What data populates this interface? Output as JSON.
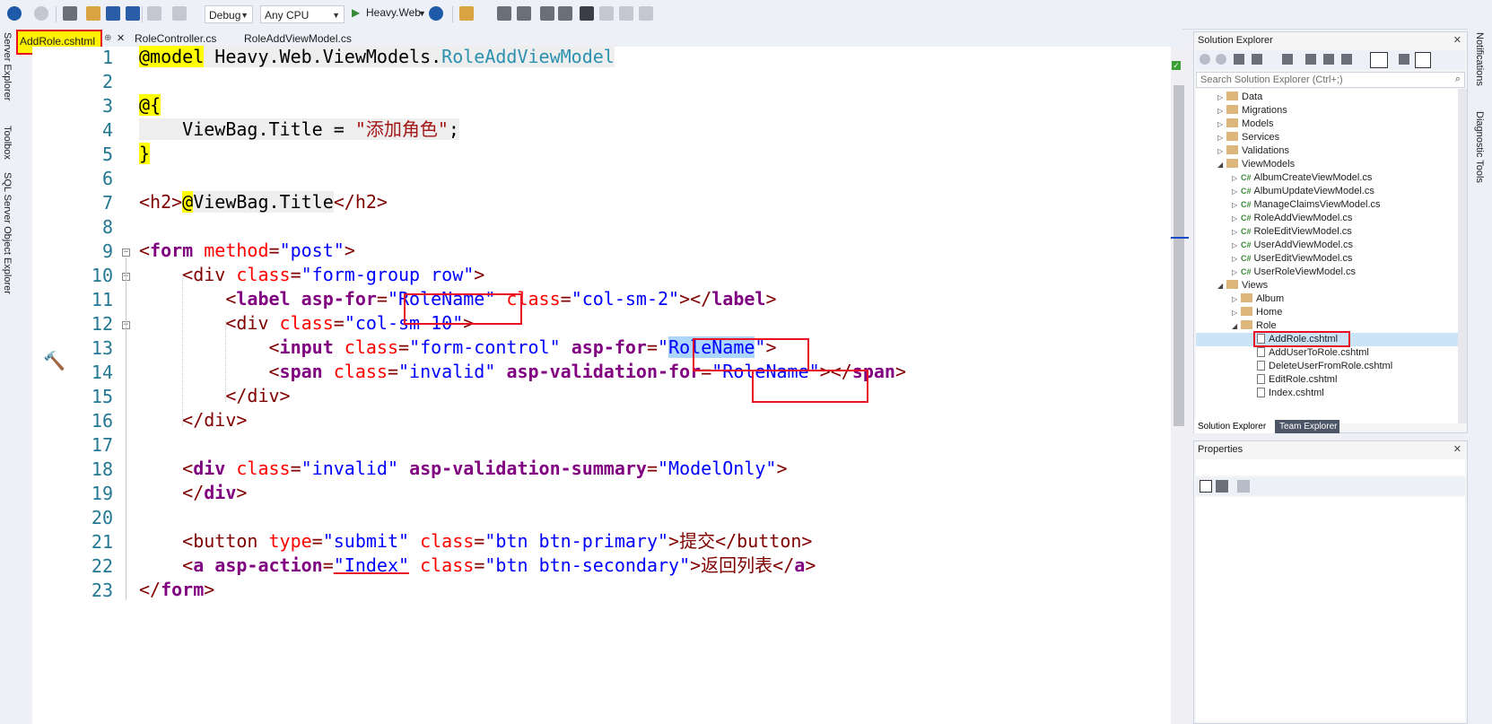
{
  "toolbar": {
    "config": "Debug",
    "platform": "Any CPU",
    "startup": "Heavy.Web"
  },
  "left_strip": [
    "Server Explorer",
    "Toolbox",
    "SQL Server Object Explorer"
  ],
  "right_strip": [
    "Notifications",
    "Diagnostic Tools"
  ],
  "tabs": [
    {
      "label": "AddRole.cshtml",
      "active": true
    },
    {
      "label": "RoleController.cs"
    },
    {
      "label": "RoleAddViewModel.cs"
    }
  ],
  "editor": {
    "line_numbers": [
      "1",
      "2",
      "3",
      "4",
      "5",
      "6",
      "7",
      "8",
      "9",
      "10",
      "11",
      "12",
      "13",
      "14",
      "15",
      "16",
      "17",
      "18",
      "19",
      "20",
      "21",
      "22",
      "23"
    ],
    "lines": {
      "l1": {
        "a": "@model",
        "b": " Heavy.Web.ViewModels.",
        "c": "RoleAddViewModel"
      },
      "l3": {
        "a": "@{"
      },
      "l4": {
        "a": "    ViewBag.Title = ",
        "b": "\"添加角色\"",
        "c": ";"
      },
      "l5": {
        "a": "}"
      },
      "l7": {
        "a": "<h2>",
        "b": "@",
        "c": "ViewBag.Title",
        "d": "</h2>"
      },
      "l9": {
        "a": "<",
        "b": "form",
        "c": " method",
        "d": "=",
        "e": "\"post\"",
        "f": ">"
      },
      "l10": {
        "a": "    <div ",
        "b": "class",
        "c": "=",
        "d": "\"form-group row\"",
        "e": ">"
      },
      "l11": {
        "a": "        <",
        "b": "label asp-for",
        "c": "=",
        "d": "\"RoleName\"",
        "e": " class",
        "f": "=",
        "g": "\"col-sm-2\"",
        "h": "></",
        "i": "label",
        "j": ">"
      },
      "l12": {
        "a": "        <div ",
        "b": "class",
        "c": "=",
        "d": "\"col-sm-10\"",
        "e": ">"
      },
      "l13": {
        "a": "            <",
        "b": "input",
        "c": " class",
        "d": "=",
        "e": "\"form-control\"",
        "f": " ",
        "g": "asp-for",
        "h": "=",
        "i": "\"",
        "j": "RoleName",
        "k": "\"",
        "l": ">"
      },
      "l14": {
        "a": "            <",
        "b": "span",
        "c": " class",
        "d": "=",
        "e": "\"invalid\"",
        "f": " ",
        "g": "asp-validation-for",
        "h": "=",
        "i": "\"RoleName\"",
        "j": "></",
        "k": "span",
        "l": ">"
      },
      "l15": {
        "a": "        </div>"
      },
      "l16": {
        "a": "    </div>"
      },
      "l18": {
        "a": "    <",
        "b": "div",
        "c": " class",
        "d": "=",
        "e": "\"invalid\"",
        "f": " ",
        "g": "asp-validation-summary",
        "h": "=",
        "i": "\"ModelOnly\"",
        "j": ">"
      },
      "l19": {
        "a": "    </",
        "b": "div",
        "c": ">"
      },
      "l21": {
        "a": "    <button ",
        "b": "type",
        "c": "=",
        "d": "\"submit\"",
        "e": " class",
        "f": "=",
        "g": "\"btn btn-primary\"",
        "h": ">提交</button>"
      },
      "l22": {
        "a": "    <",
        "b": "a asp-action",
        "c": "=",
        "d": "\"Index\"",
        "e": " class",
        "f": "=",
        "g": "\"btn btn-secondary\"",
        "h": ">返回列表</",
        "i": "a",
        "j": ">"
      },
      "l23": {
        "a": "</",
        "b": "form",
        "c": ">"
      }
    }
  },
  "solution_explorer": {
    "title": "Solution Explorer",
    "search_placeholder": "Search Solution Explorer (Ctrl+;)",
    "items": [
      {
        "label": "Data",
        "kind": "folder",
        "level": 1
      },
      {
        "label": "Migrations",
        "kind": "folder",
        "level": 1
      },
      {
        "label": "Models",
        "kind": "folder",
        "level": 1
      },
      {
        "label": "Services",
        "kind": "folder",
        "level": 1
      },
      {
        "label": "Validations",
        "kind": "folder",
        "level": 1
      },
      {
        "label": "ViewModels",
        "kind": "folder",
        "level": 1
      },
      {
        "label": "AlbumCreateViewModel.cs",
        "kind": "cs",
        "level": 2
      },
      {
        "label": "AlbumUpdateViewModel.cs",
        "kind": "cs",
        "level": 2
      },
      {
        "label": "ManageClaimsViewModel.cs",
        "kind": "cs",
        "level": 2
      },
      {
        "label": "RoleAddViewModel.cs",
        "kind": "cs",
        "level": 2
      },
      {
        "label": "RoleEditViewModel.cs",
        "kind": "cs",
        "level": 2
      },
      {
        "label": "UserAddViewModel.cs",
        "kind": "cs",
        "level": 2
      },
      {
        "label": "UserEditViewModel.cs",
        "kind": "cs",
        "level": 2
      },
      {
        "label": "UserRoleViewModel.cs",
        "kind": "cs",
        "level": 2
      },
      {
        "label": "Views",
        "kind": "folder",
        "level": 1
      },
      {
        "label": "Album",
        "kind": "folder",
        "level": 2
      },
      {
        "label": "Home",
        "kind": "folder",
        "level": 2
      },
      {
        "label": "Role",
        "kind": "folder",
        "level": 2
      },
      {
        "label": "AddRole.cshtml",
        "kind": "file",
        "level": 3
      },
      {
        "label": "AddUserToRole.cshtml",
        "kind": "file",
        "level": 3
      },
      {
        "label": "DeleteUserFromRole.cshtml",
        "kind": "file",
        "level": 3
      },
      {
        "label": "EditRole.cshtml",
        "kind": "file",
        "level": 3
      },
      {
        "label": "Index.cshtml",
        "kind": "file",
        "level": 3
      }
    ],
    "tab_solution": "Solution Explorer",
    "tab_team": "Team Explorer"
  },
  "properties": {
    "title": "Properties"
  }
}
